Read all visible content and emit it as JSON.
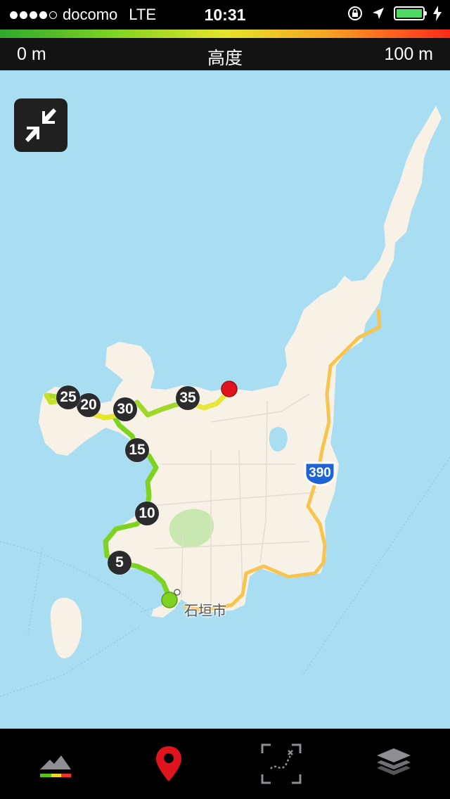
{
  "status_bar": {
    "carrier": "docomo",
    "network": "LTE",
    "time": "10:31",
    "signal_bars_filled": 4,
    "signal_bars_total": 5,
    "battery_level": 1.0,
    "battery_color": "#4cd964"
  },
  "elevation_legend": {
    "min_label": "0 m",
    "title": "高度",
    "max_label": "100 m",
    "gradient_colors": [
      "#2fa82c",
      "#7ed321",
      "#e6e52a",
      "#f5a623",
      "#ff2a1a"
    ]
  },
  "map": {
    "city_label": "石垣市",
    "route_number": "390",
    "distance_markers": [
      "5",
      "10",
      "15",
      "20",
      "25",
      "30",
      "35"
    ],
    "start_color": "#7ed321",
    "end_color": "#e0141e",
    "water_color": "#a9ddf2",
    "land_color": "#f7f2e5",
    "park_color": "#c9e7b0",
    "road_color": "#f6c44f"
  },
  "controls": {
    "collapse_icon": "collapse-arrows-icon"
  },
  "tab_bar": {
    "tabs": [
      {
        "icon": "elevation-icon"
      },
      {
        "icon": "location-pin-icon",
        "active_color": "#e0141e"
      },
      {
        "icon": "fit-route-icon"
      },
      {
        "icon": "layers-icon"
      }
    ]
  }
}
